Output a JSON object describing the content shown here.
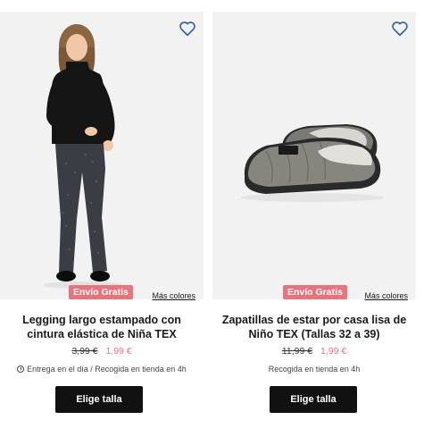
{
  "products": [
    {
      "name": "Legging largo estampado con cintura elástica de Niña TEX",
      "badge": "Envío Gratis",
      "more_colors": "Más colores",
      "old_price": "3,99 €",
      "new_price": "1,99 €",
      "delivery": "Entrega en el día / Recogida en tienda en 4h",
      "button": "Elige talla",
      "wishlist_icon": "heart-outline-icon"
    },
    {
      "name": "Zapatillas de estar por casa lisa de Niño TEX (Tallas 32 a 39)",
      "badge": "Envío Gratis",
      "more_colors": "Más colores",
      "old_price": "11,99 €",
      "new_price": "1,99 €",
      "delivery": "Recogida en tienda en 4h",
      "button": "Elige talla",
      "wishlist_icon": "heart-outline-icon"
    }
  ],
  "colors": {
    "accent": "#e8737a",
    "button_bg": "#111111",
    "wishlist": "#2e5fa0",
    "image_bg": "#f2f2f2"
  }
}
